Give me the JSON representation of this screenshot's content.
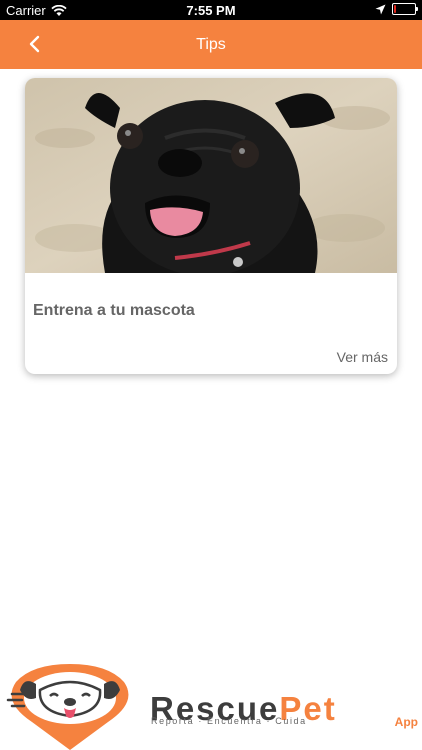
{
  "status_bar": {
    "carrier": "Carrier",
    "time": "7:55 PM",
    "battery_level": 0.1,
    "battery_color": "#e0281e"
  },
  "nav": {
    "title": "Tips",
    "back_icon": "chevron-left-icon",
    "background": "#f5823f"
  },
  "cards": [
    {
      "image": "black-pug-on-sand",
      "title": "Entrena a tu mascota",
      "link_label": "Ver más"
    }
  ],
  "footer": {
    "brand_part1": "Rescue",
    "brand_part2": "Pet",
    "tagline": "Reporta · Encuentra · Cuida",
    "app_label": "App",
    "accent": "#f5823f"
  }
}
